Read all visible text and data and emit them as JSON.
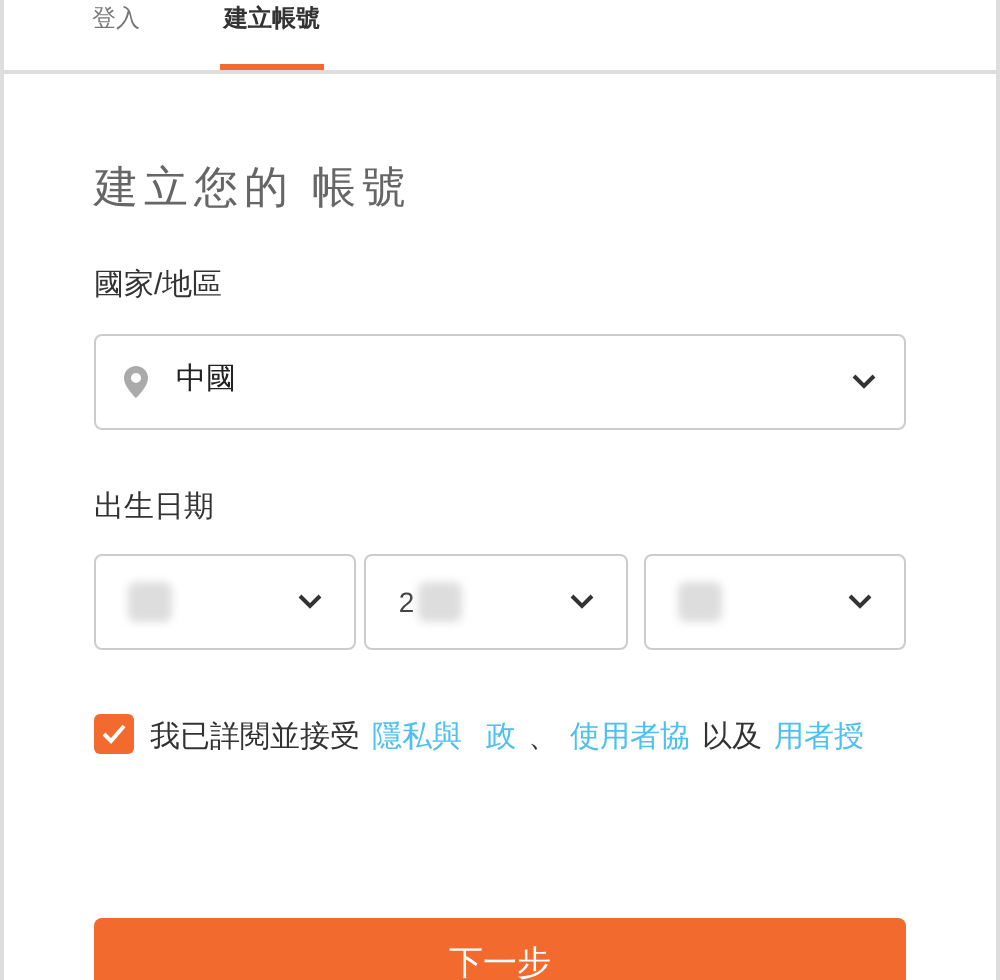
{
  "tabs": [
    {
      "label": "登入",
      "selected": false
    },
    {
      "label": "建立帳號",
      "selected": true
    }
  ],
  "title": "建立您的 帳號",
  "country": {
    "label": "國家/地區",
    "value": "中國"
  },
  "birth": {
    "label": "出生日期",
    "selects": [
      {
        "blurred": true
      },
      {
        "value": "2",
        "blurred": true
      },
      {
        "blurred": true
      }
    ]
  },
  "agreement": {
    "checked": true,
    "parts": [
      {
        "kind": "text",
        "text": "我已詳閱並接受"
      },
      {
        "kind": "link",
        "text": "隱私與"
      },
      {
        "kind": "link",
        "text": "政"
      },
      {
        "kind": "text",
        "text": "、"
      },
      {
        "kind": "link",
        "text": "使用者協"
      },
      {
        "kind": "text",
        "text": "以及"
      },
      {
        "kind": "link",
        "text": "用者授"
      }
    ]
  },
  "next_button": "下一步"
}
